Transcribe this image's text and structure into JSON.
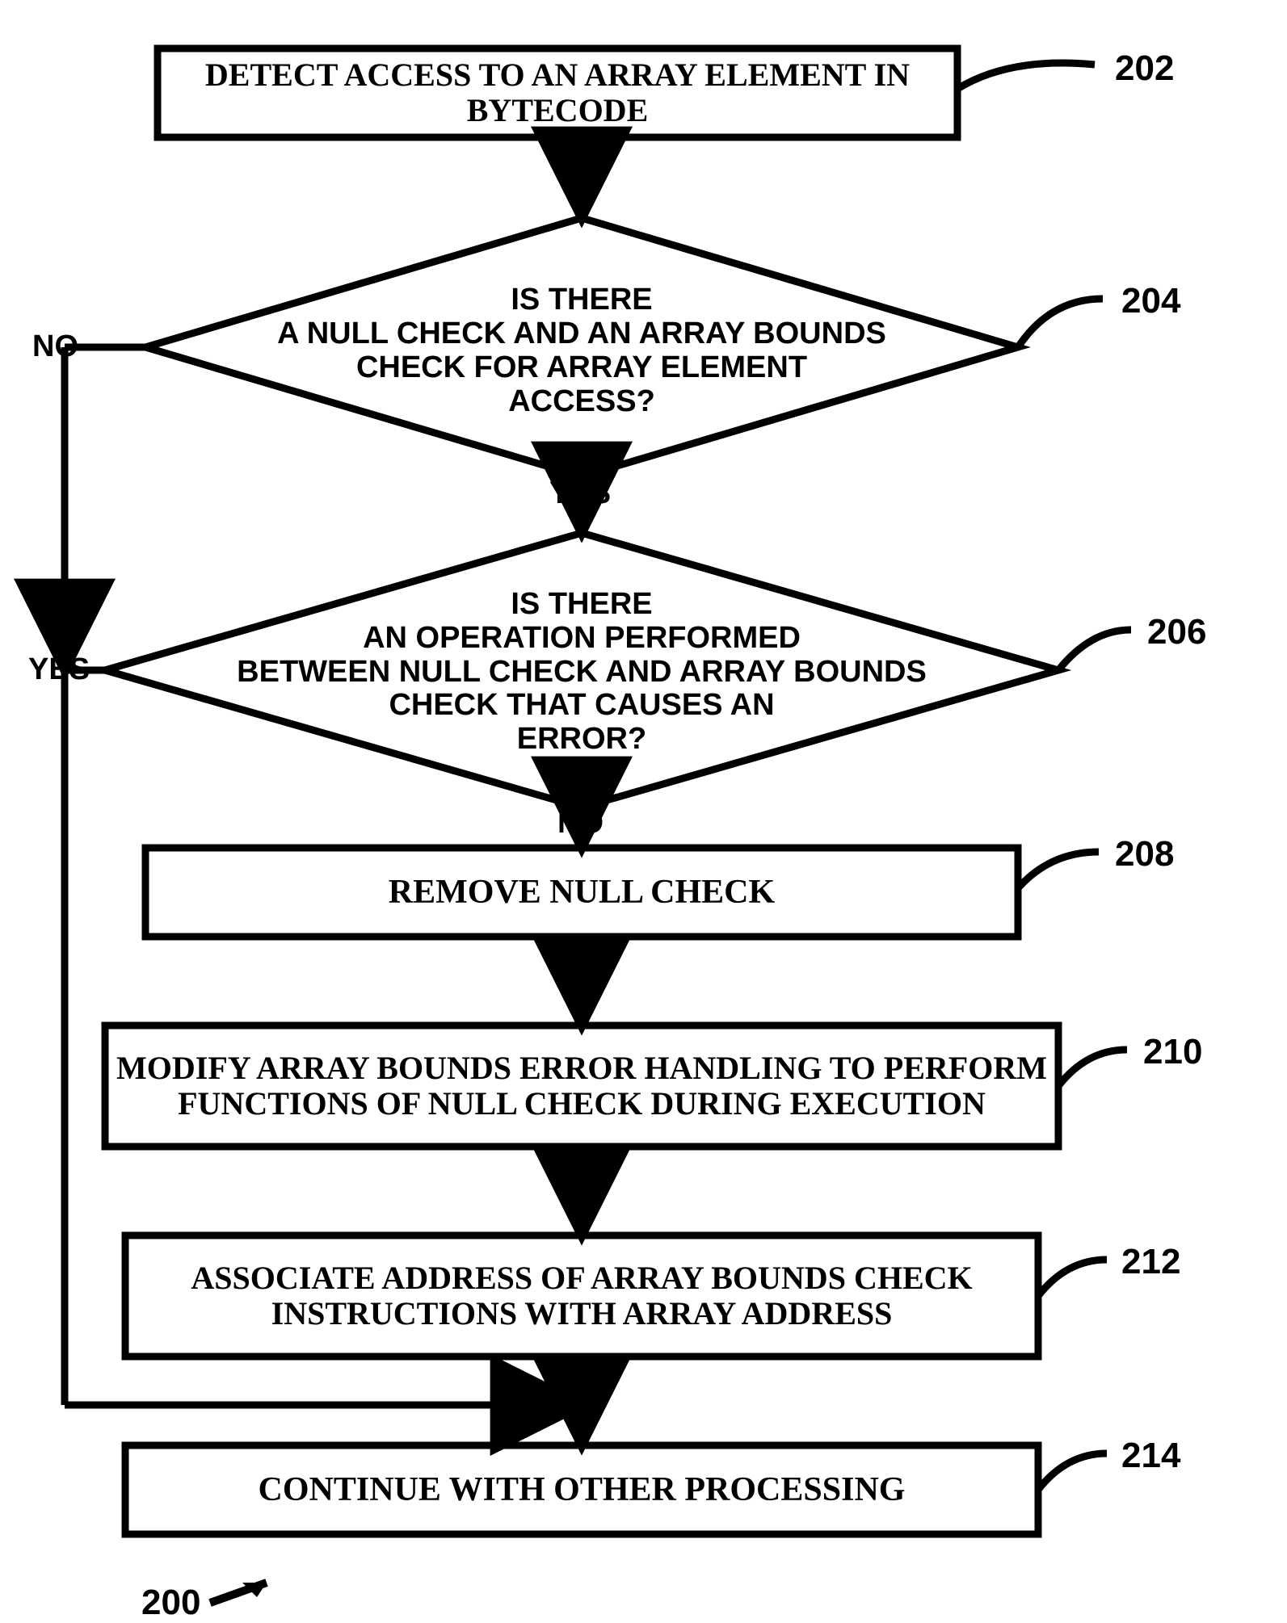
{
  "flow": {
    "step1": "DETECT ACCESS TO AN ARRAY ELEMENT IN BYTECODE",
    "decision1_l1": "IS THERE",
    "decision1_l2": "A NULL CHECK AND AN ARRAY BOUNDS",
    "decision1_l3": "CHECK FOR ARRAY ELEMENT",
    "decision1_l4": "ACCESS?",
    "decision2_l1": "IS THERE",
    "decision2_l2": "AN OPERATION PERFORMED",
    "decision2_l3": "BETWEEN NULL CHECK AND ARRAY BOUNDS",
    "decision2_l4": "CHECK THAT CAUSES AN",
    "decision2_l5": "ERROR?",
    "step3": "REMOVE NULL CHECK",
    "step4_l1": "MODIFY ARRAY BOUNDS ERROR HANDLING TO PERFORM",
    "step4_l2": "FUNCTIONS OF NULL CHECK DURING EXECUTION",
    "step5_l1": "ASSOCIATE ADDRESS OF ARRAY BOUNDS CHECK",
    "step5_l2": "INSTRUCTIONS WITH ARRAY ADDRESS",
    "step6": "CONTINUE WITH OTHER PROCESSING"
  },
  "labels": {
    "no1": "NO",
    "yes1": "YES",
    "yes2": "YES",
    "no2": "NO"
  },
  "refs": {
    "r202": "202",
    "r204": "204",
    "r206": "206",
    "r208": "208",
    "r210": "210",
    "r212": "212",
    "r214": "214",
    "r200": "200"
  }
}
